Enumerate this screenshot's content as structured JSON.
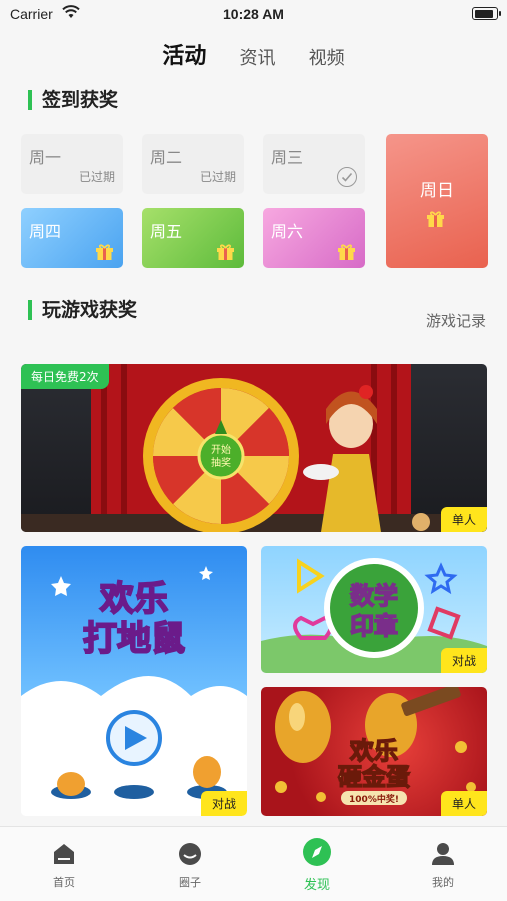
{
  "status_bar": {
    "carrier": "Carrier",
    "time": "10:28 AM"
  },
  "tabs": [
    {
      "label": "活动",
      "active": true
    },
    {
      "label": "资讯",
      "active": false
    },
    {
      "label": "视频",
      "active": false
    }
  ],
  "signin": {
    "title": "签到获奖",
    "days": [
      {
        "name": "周一",
        "status": "已过期"
      },
      {
        "name": "周二",
        "status": "已过期"
      },
      {
        "name": "周三",
        "status": "已签到"
      },
      {
        "name": "周四",
        "status": "礼物"
      },
      {
        "name": "周五",
        "status": "礼物"
      },
      {
        "name": "周六",
        "status": "礼物"
      },
      {
        "name": "周日",
        "status": "礼物"
      }
    ]
  },
  "games": {
    "title": "玩游戏获奖",
    "record_link": "游戏记录",
    "main_banner": {
      "free_tag": "每日免费2次",
      "wheel_center": "开始\n抽奖",
      "mode": "单人"
    },
    "mole": {
      "title_line1": "欢乐",
      "title_line2": "打地鼠",
      "mode": "对战"
    },
    "math": {
      "title_line1": "数学",
      "title_line2": "印章",
      "mode": "对战"
    },
    "egg": {
      "title_line1": "欢乐",
      "title_line2": "砸金蛋",
      "badge": "100%中奖!",
      "mode": "单人"
    }
  },
  "bottom_nav": [
    {
      "label": "首页",
      "icon": "home-icon",
      "active": false
    },
    {
      "label": "圈子",
      "icon": "circle-icon",
      "active": false
    },
    {
      "label": "发现",
      "icon": "compass-icon",
      "active": true
    },
    {
      "label": "我的",
      "icon": "person-icon",
      "active": false
    }
  ],
  "colors": {
    "accent": "#2ec154",
    "tag_yellow": "#ffe51c"
  }
}
